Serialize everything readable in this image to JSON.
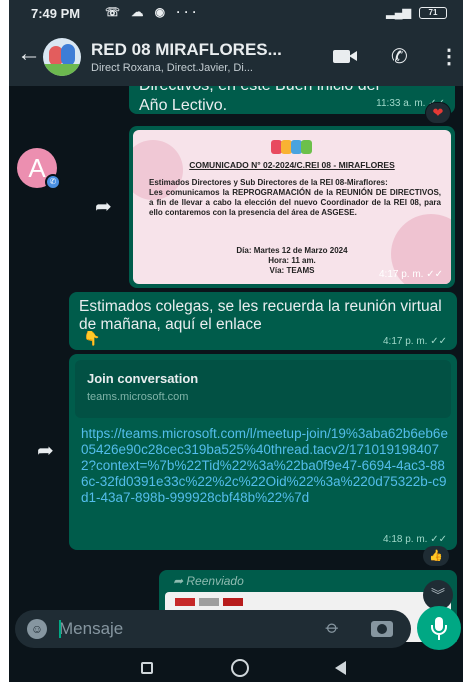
{
  "status_bar": {
    "time": "7:49 PM",
    "battery": "71"
  },
  "header": {
    "back_icon": "arrow-left-icon",
    "title": "RED 08 MIRAFLORES...",
    "subtitle": "Direct Roxana, Direct.Javier, Di..."
  },
  "messages": {
    "m1": {
      "text_line1": "Directivos, en este Buen inicio del",
      "text_line2": "Año Lectivo.",
      "time": "11:33 a. m.",
      "reaction": "❤"
    },
    "sender_avatar_letter": "A",
    "m2": {
      "image_title": "COMUNICADO N° 02-2024/C.REI 08 - MIRAFLORES",
      "image_body_1": "Estimados Directores y Sub Directores de la REI 08-Miraflores:",
      "image_body_2": "Les comunicamos la REPROGRAMACIÓN de la REUNIÓN DE DIRECTIVOS, a fin de llevar a cabo la elección del nuevo Coordinador de la REI 08, para ello contaremos con la presencia del área de ASGESE.",
      "image_date": "Día: Martes 12 de Marzo 2024",
      "image_hour": "Hora: 11 am.",
      "image_via": "Vía: TEAMS",
      "time": "4:17 p. m."
    },
    "m3": {
      "text": "Estimados colegas, se les recuerda la reunión virtual de mañana, aquí el enlace",
      "time": "4:17 p. m."
    },
    "m4": {
      "preview_title": "Join conversation",
      "preview_domain": "teams.microsoft.com",
      "link": "https://teams.microsoft.com/l/meetup-join/19%3aba62b6eb6e05426e90c28cec319ba525%40thread.tacv2/1710191984072?context=%7b%22Tid%22%3a%22ba0f9e47-6694-4ac3-886c-32fd0391e33c%22%2c%22Oid%22%3a%220d75322b-c9d1-43a7-898b-999928cbf48b%22%7d",
      "time": "4:18 p. m.",
      "reaction": "👍"
    },
    "m5": {
      "forwarded_label": "Reenviado"
    }
  },
  "composer": {
    "placeholder": "Mensaje"
  }
}
